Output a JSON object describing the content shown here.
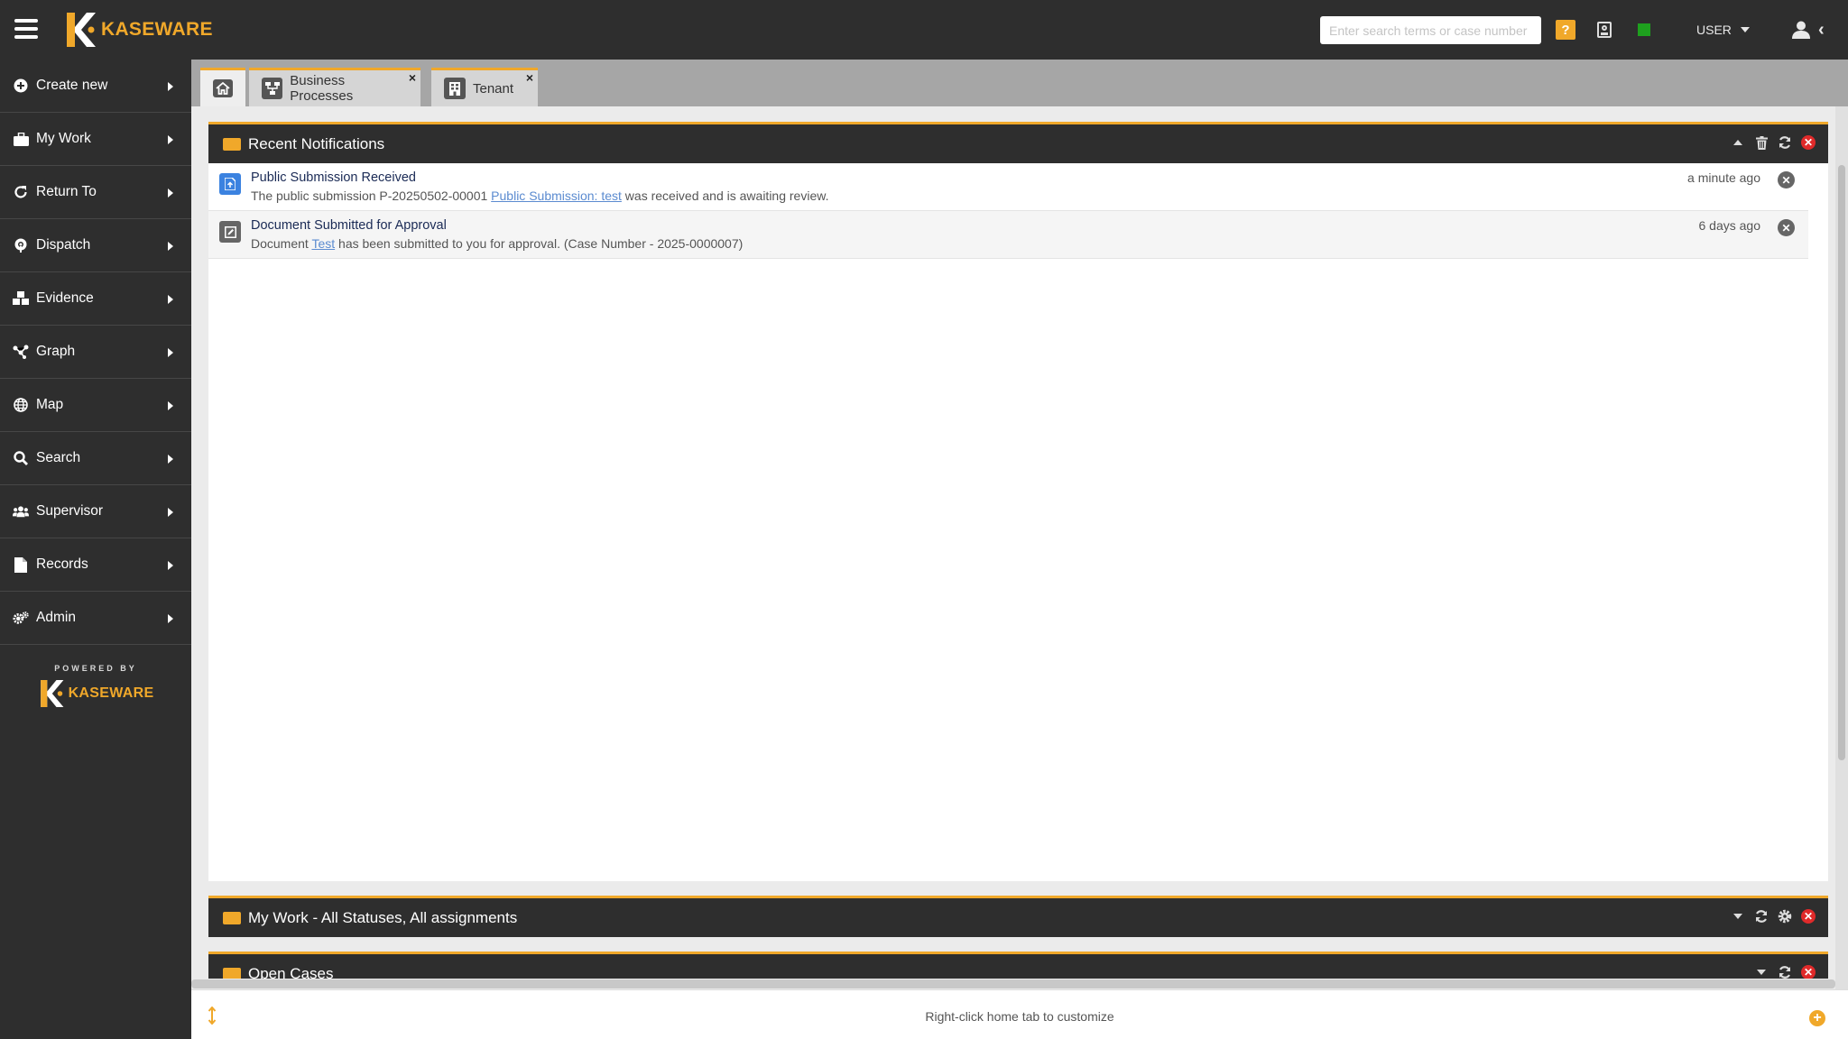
{
  "brand": {
    "name": "KASEWARE",
    "powered_by": "POWERED BY",
    "accent": "#f0a82a"
  },
  "header": {
    "search_placeholder": "Enter search terms or case number",
    "help_label": "?",
    "user_label": "USER",
    "status_color": "#1ea01e"
  },
  "sidebar": {
    "items": [
      {
        "label": "Create new",
        "icon": "plus-circle-icon"
      },
      {
        "label": "My Work",
        "icon": "briefcase-icon"
      },
      {
        "label": "Return To",
        "icon": "refresh-icon"
      },
      {
        "label": "Dispatch",
        "icon": "broadcast-icon"
      },
      {
        "label": "Evidence",
        "icon": "cubes-icon"
      },
      {
        "label": "Graph",
        "icon": "graph-icon"
      },
      {
        "label": "Map",
        "icon": "globe-icon"
      },
      {
        "label": "Search",
        "icon": "search-icon"
      },
      {
        "label": "Supervisor",
        "icon": "users-icon"
      },
      {
        "label": "Records",
        "icon": "document-icon"
      },
      {
        "label": "Admin",
        "icon": "gears-icon"
      }
    ]
  },
  "tabs": [
    {
      "label": "Business Processes",
      "icon": "process-icon",
      "close": "×"
    },
    {
      "label": "Tenant",
      "icon": "building-icon",
      "close": "×"
    }
  ],
  "notifications_panel": {
    "title": "Recent Notifications",
    "items": [
      {
        "title": "Public Submission Received",
        "body_prefix": "The public submission P-20250502-00001 ",
        "link": "Public Submission: test",
        "body_suffix": " was received and is awaiting review.",
        "time": "a minute ago",
        "icon": "submission-icon"
      },
      {
        "title": "Document Submitted for Approval",
        "body_prefix": "Document ",
        "link": "Test",
        "body_suffix": " has been submitted to you for approval. (Case Number - 2025-0000007)",
        "time": "6 days ago",
        "icon": "edit-document-icon"
      }
    ]
  },
  "my_work_panel": {
    "title": "My Work - All Statuses, All assignments"
  },
  "open_cases_panel": {
    "title": "Open Cases"
  },
  "footer": {
    "hint": "Right-click home tab to customize"
  }
}
